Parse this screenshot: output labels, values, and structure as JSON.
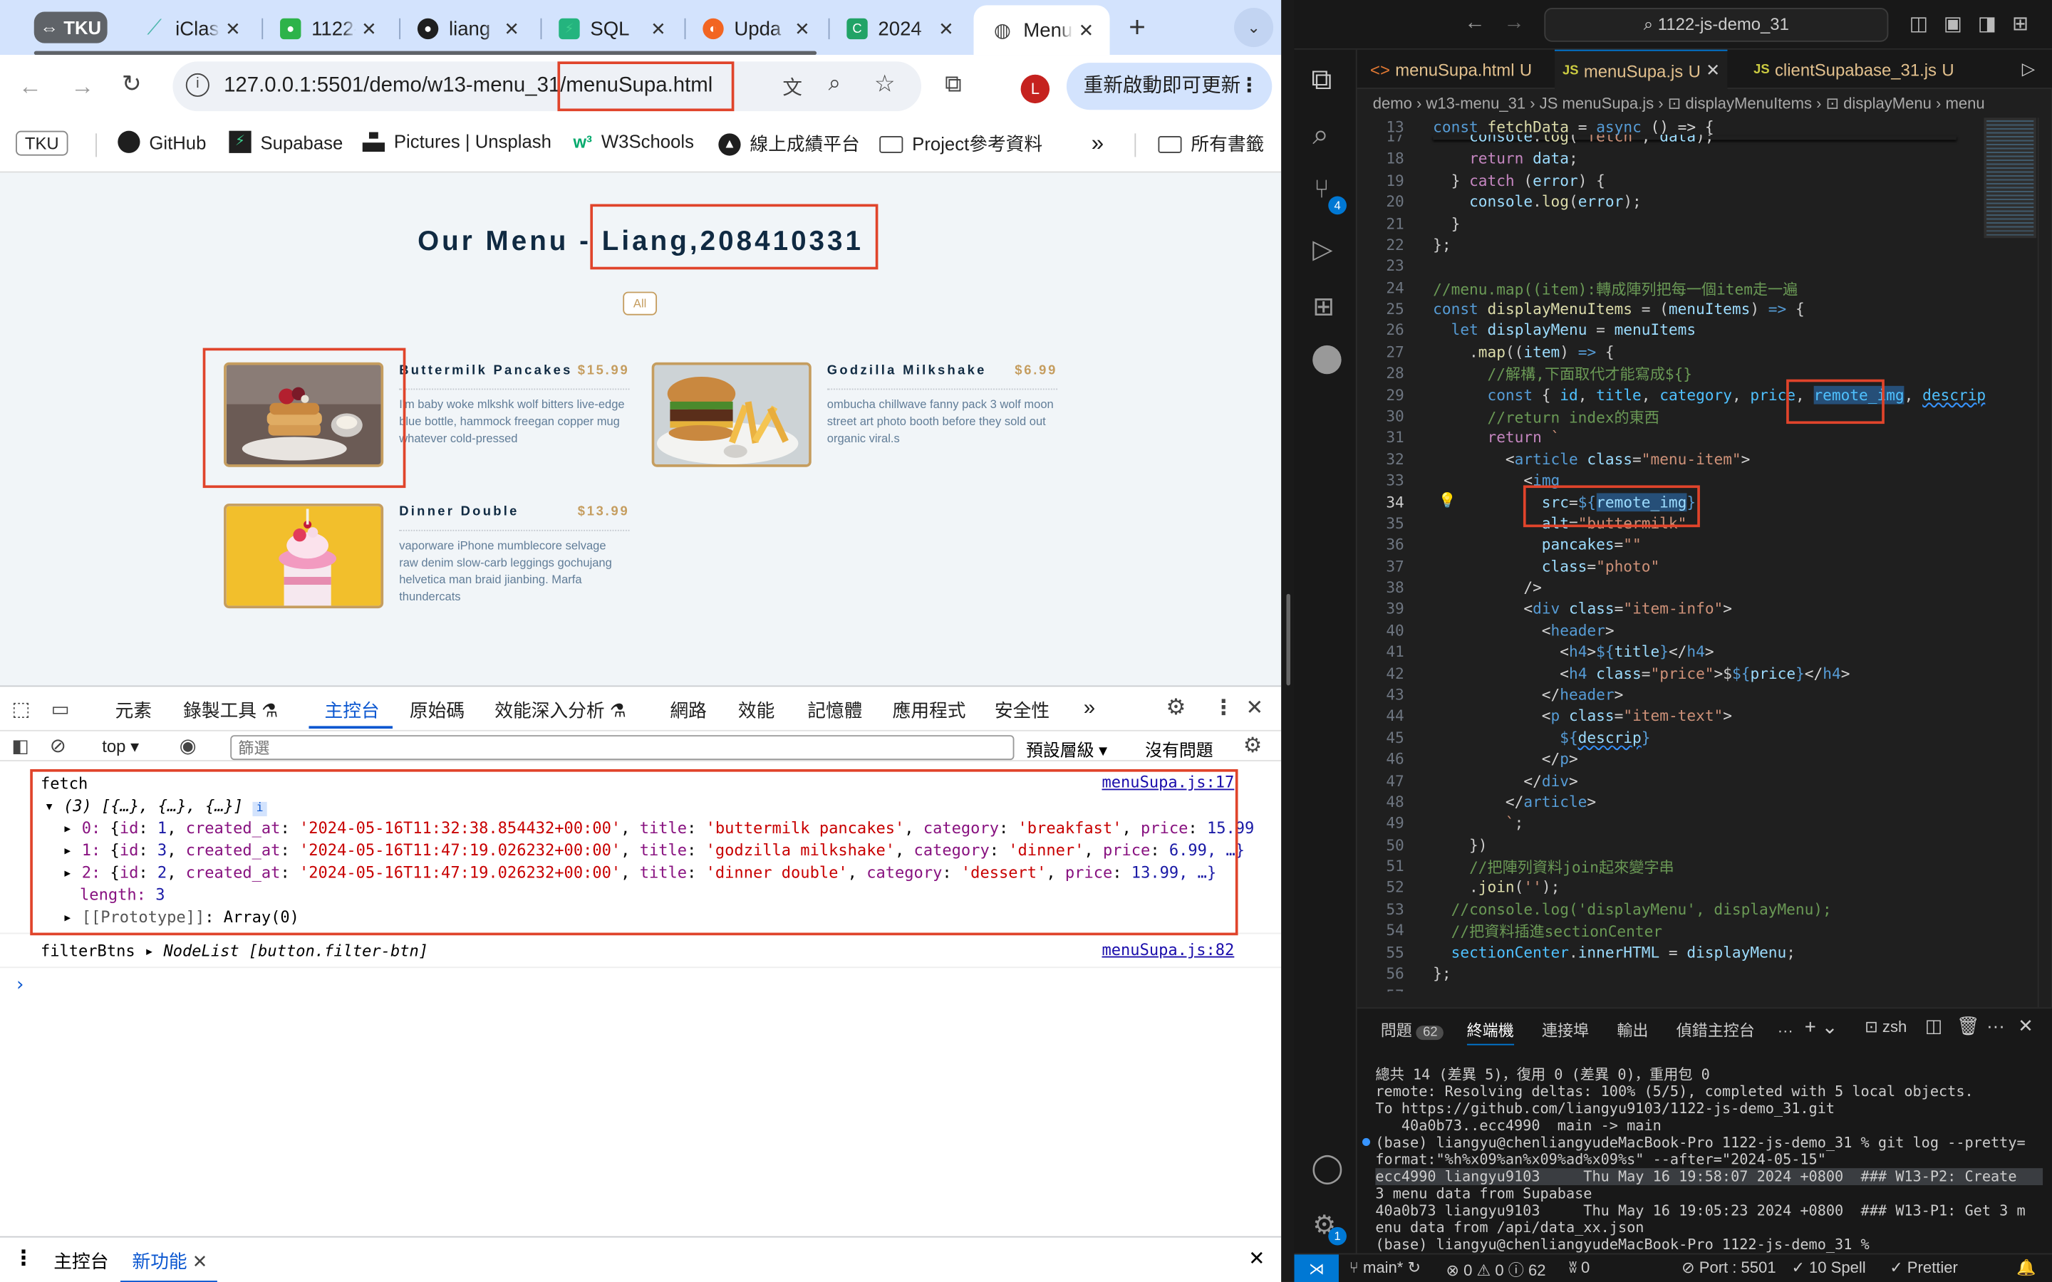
{
  "browser": {
    "tabs": [
      {
        "label": "TKU",
        "color": "#5f6368"
      },
      {
        "label": "iClass",
        "color": "#4db6ac"
      },
      {
        "label": "1122-",
        "color": "#2db34a"
      },
      {
        "label": "liang",
        "color": "#1f1f1f"
      },
      {
        "label": "SQL",
        "color": "#24b47e"
      },
      {
        "label": "Upda",
        "color": "#f26522"
      },
      {
        "label": "2024",
        "color": "#21a366"
      },
      {
        "label": "Menu",
        "color": "#5f6368"
      }
    ],
    "new_tab": "+",
    "url_prefix": "127.0.0.1:5501/demo/w13-menu_31/",
    "url_file": "menuSupa.html",
    "profile_initial": "L",
    "update_label": "重新啟動即可更新",
    "bookmarks": [
      "TKU",
      "GitHub",
      "Supabase",
      "Pictures | Unsplash",
      "W3Schools",
      "線上成績平台",
      "Project參考資料"
    ],
    "all_bookmarks": "所有書籤"
  },
  "page": {
    "title_prefix": "Our Menu - ",
    "title_name": "Liang,208410331",
    "filter_all": "All",
    "items": [
      {
        "title": "Buttermilk Pancakes",
        "price": "$15.99",
        "desc": "I'm baby woke mlkshk wolf bitters live-edge blue bottle, hammock freegan copper mug whatever cold-pressed"
      },
      {
        "title": "Godzilla Milkshake",
        "price": "$6.99",
        "desc": "ombucha chillwave fanny pack 3 wolf moon street art photo booth before they sold out organic viral.s"
      },
      {
        "title": "Dinner Double",
        "price": "$13.99",
        "desc": "vaporware iPhone mumblecore selvage raw denim slow-carb leggings gochujang helvetica man braid jianbing. Marfa thundercats"
      }
    ]
  },
  "devtools": {
    "tabs": [
      "元素",
      "錄製工具",
      "主控台",
      "原始碼",
      "效能深入分析",
      "網路",
      "效能",
      "記憶體",
      "應用程式",
      "安全性"
    ],
    "context": "top",
    "filter_placeholder": "篩選",
    "levels": "預設層級",
    "issues": "沒有問題",
    "log1_label": "fetch",
    "log1_src": "menuSupa.js:17",
    "array_summary": "(3) [{…}, {…}, {…}]",
    "rows": [
      {
        "idx": "0",
        "id": "1",
        "created_at": "'2024-05-16T11:32:38.854432+00:00'",
        "title": "'buttermilk pancakes'",
        "category": "'breakfast'",
        "price": "15.99"
      },
      {
        "idx": "1",
        "id": "3",
        "created_at": "'2024-05-16T11:47:19.026232+00:00'",
        "title": "'godzilla milkshake'",
        "category": "'dinner'",
        "price": "6.99, …}"
      },
      {
        "idx": "2",
        "id": "2",
        "created_at": "'2024-05-16T11:47:19.026232+00:00'",
        "title": "'dinner double'",
        "category": "'dessert'",
        "price": "13.99, …}"
      }
    ],
    "length_label": "length",
    "length_value": "3",
    "prototype": "[[Prototype]]",
    "prototype_value": "Array(0)",
    "log2_label": "filterBtns",
    "log2_value": "NodeList [button.filter-btn]",
    "log2_src": "menuSupa.js:82",
    "drawer_tabs": [
      "主控台",
      "新功能"
    ]
  },
  "vscode": {
    "search": "1122-js-demo_31",
    "tabs": [
      {
        "name": "menuSupa.html",
        "badge": "U"
      },
      {
        "name": "menuSupa.js",
        "badge": "U"
      },
      {
        "name": "clientSupabase_31.js",
        "badge": "U"
      }
    ],
    "breadcrumb": "demo  ›  w13-menu_31  ›  JS menuSupa.js  ›  ⊡ displayMenuItems  ›  ⊡ displayMenu  ›  menu",
    "line_numbers": [
      "13",
      "17",
      "18",
      "19",
      "20",
      "21",
      "22",
      "23",
      "24",
      "25",
      "26",
      "27",
      "28",
      "29",
      "30",
      "31",
      "32",
      "33",
      "34",
      "35",
      "36",
      "37",
      "38",
      "39",
      "40",
      "41",
      "42",
      "43",
      "44",
      "45",
      "46",
      "47",
      "48",
      "49",
      "50",
      "51",
      "52",
      "53",
      "54",
      "55",
      "56",
      "57"
    ],
    "panel_tabs": [
      "問題",
      "62",
      "終端機",
      "連接埠",
      "輸出",
      "偵錯主控台"
    ],
    "shell": "zsh",
    "terminal": [
      "總共 14 (差異 5)，復用 0 (差異 0)，重用包 0",
      "remote: Resolving deltas: 100% (5/5), completed with 5 local objects.",
      "To https://github.com/liangyu9103/1122-js-demo_31.git",
      "   40a0b73..ecc4990  main -> main",
      "(base) liangyu@chenliangyudeMacBook-Pro 1122-js-demo_31 % git log --pretty=",
      "format:\"%h%x09%an%x09%ad%x09%s\" --after=\"2024-05-15\"",
      "ecc4990 liangyu9103     Thu May 16 19:58:07 2024 +0800  ### W13-P2: Create",
      "3 menu data from Supabase",
      "40a0b73 liangyu9103     Thu May 16 19:05:23 2024 +0800  ### W13-P1: Get 3 m",
      "enu data from /api/data_xx.json",
      "(base) liangyu@chenliangyudeMacBook-Pro 1122-js-demo_31 % "
    ],
    "status": {
      "branch": "main*",
      "problems": "⊗ 0 ⚠ 0 ⓘ 62",
      "ports": "ʬ 0",
      "port": "Port : 5501",
      "spell": "10 Spell",
      "prettier": "✓ Prettier"
    }
  }
}
